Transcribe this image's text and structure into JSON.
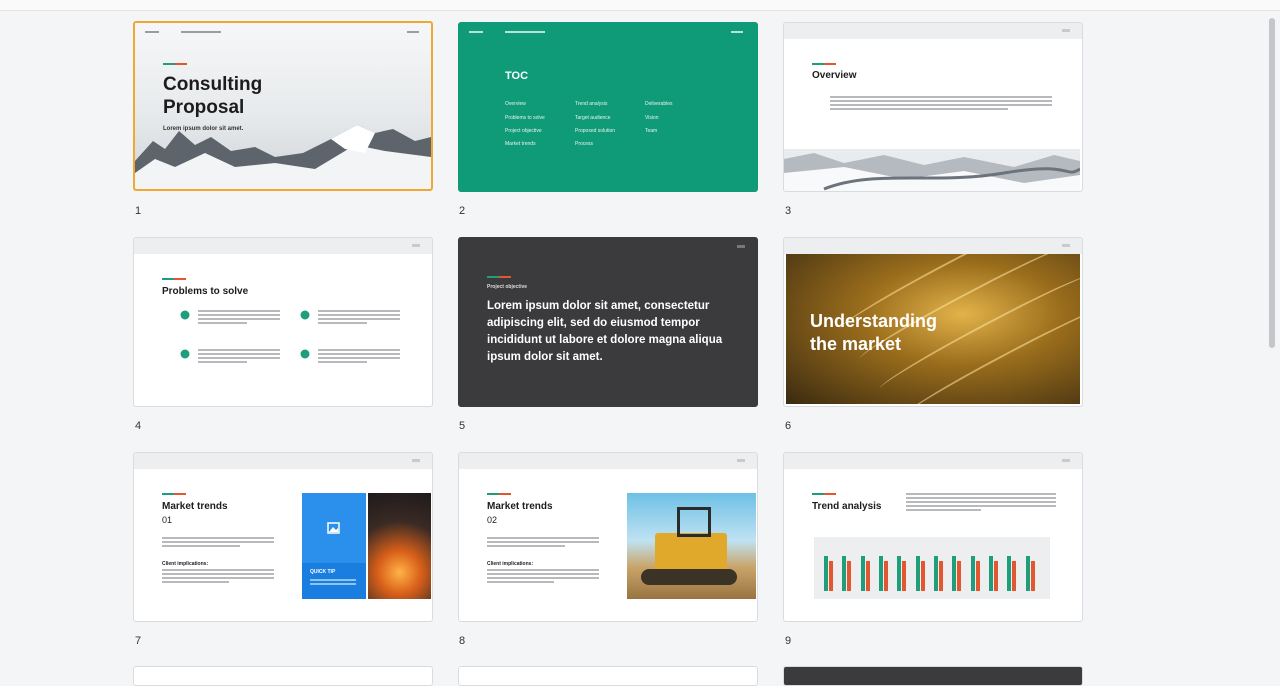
{
  "colors": {
    "accent_green": "#1e9e7c",
    "accent_red": "#e2572f",
    "selection": "#f0a830",
    "toc_green": "#0f9a78",
    "dark_slide": "#3b3b3d",
    "tip_blue": "#1a7ee0"
  },
  "slides": [
    {
      "number": "1",
      "title_line1": "Consulting",
      "title_line2": "Proposal",
      "subtitle": "Lorem ipsum dolor sit amet."
    },
    {
      "number": "2",
      "title": "TOC",
      "toc_items": [
        "Overview",
        "Trend analysis",
        "Deliverables",
        "Problems to solve",
        "Target audience",
        "Vision",
        "Project objective",
        "Proposed solution",
        "Team",
        "Market trends",
        "Process"
      ]
    },
    {
      "number": "3",
      "title": "Overview"
    },
    {
      "number": "4",
      "title": "Problems to solve"
    },
    {
      "number": "5",
      "label": "Project objective",
      "body": "Lorem ipsum dolor sit amet, consectetur adipiscing elit, sed do eiusmod tempor incididunt ut labore et dolore magna aliqua ipsum dolor sit amet."
    },
    {
      "number": "6",
      "title_line1": "Understanding",
      "title_line2": "the market"
    },
    {
      "number": "7",
      "title": "Market trends",
      "sub": "01",
      "client_label": "Client implications:",
      "tip_label": "QUICK TIP"
    },
    {
      "number": "8",
      "title": "Market trends",
      "sub": "02",
      "client_label": "Client implications:"
    },
    {
      "number": "9",
      "title": "Trend analysis"
    }
  ],
  "chart_data": {
    "type": "bar",
    "categories": [
      "1",
      "2",
      "3",
      "4",
      "5",
      "6",
      "7",
      "8",
      "9",
      "10",
      "11",
      "12"
    ],
    "series": [
      {
        "values": [
          0.95,
          0.95,
          0.95,
          0.95,
          0.95,
          0.95,
          0.95,
          0.95,
          0.95,
          0.95,
          0.95,
          0.95
        ]
      },
      {
        "values": [
          0.82,
          0.82,
          0.82,
          0.82,
          0.82,
          0.82,
          0.82,
          0.82,
          0.82,
          0.82,
          0.82,
          0.82
        ]
      }
    ],
    "series_colors": [
      "#1e9e7c",
      "#e2572f"
    ],
    "grid": true,
    "legend": "bottom"
  }
}
